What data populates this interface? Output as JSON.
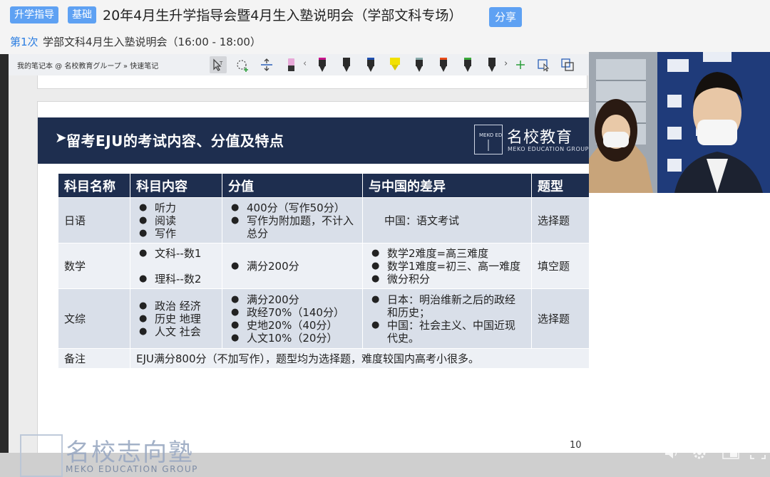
{
  "header": {
    "tags": [
      "升学指导",
      "基础"
    ],
    "title": "20年4月生升学指导会暨4月生入塾说明会（学部文科专场）",
    "share_label": "分享",
    "session_number": "第1次",
    "session_desc": "学部文科4月生入塾说明会（16:00 - 18:00）"
  },
  "toolbar": {
    "breadcrumb": "我的笔记本 @ 名校教育グループ » 快速笔记",
    "pen_colors": [
      "#c7148a",
      "#111111",
      "#1f4fae",
      "#2059c4",
      "#f2e100",
      "#111111",
      "#e84a17",
      "#3aa93a",
      "#111111"
    ]
  },
  "slide": {
    "title": "留考EJU的考试内容、分值及特点",
    "logo_cn": "名校教育",
    "logo_en": "MEKO EDUCATION GROUP",
    "logo_box_text": "MEKO EDU",
    "page_number": "10",
    "table": {
      "headers": [
        "科目名称",
        "科目内容",
        "分值",
        "与中国的差异",
        "题型"
      ],
      "rows": [
        {
          "subject": "日语",
          "content": [
            "听力",
            "阅读",
            "写作"
          ],
          "score": [
            "400分（写作50分）",
            "写作为附加题，不计入总分"
          ],
          "diff_text": "中国：语文考试",
          "type": "选择题"
        },
        {
          "subject": "数学",
          "content": [
            "文科--数1",
            "理科--数2"
          ],
          "score": [
            "满分200分"
          ],
          "diff": [
            "数学2难度=高三难度",
            "数学1难度=初三、高一难度",
            "微分积分"
          ],
          "type": "填空题"
        },
        {
          "subject": "文综",
          "content": [
            "政治 经济",
            "历史 地理",
            "人文 社会"
          ],
          "score": [
            "满分200分",
            "政经70%（140分）",
            "史地20%（40分）",
            "人文10%（20分）"
          ],
          "diff": [
            "日本：明治维新之后的政经和历史；",
            "中国：社会主义、中国近现代史。"
          ],
          "type": "选择题"
        }
      ],
      "note_label": "备注",
      "note_text": "EJU满分800分（不加写作），题型均为选择题，难度较国内高考小很多。"
    }
  },
  "watermark": {
    "cn": "名校志向塾",
    "en": "MEKO EDUCATION GROUP"
  },
  "colors": {
    "accent": "#5ea1f3",
    "banner": "#1e2e4f",
    "table_row": "#d9dfe9",
    "table_row_alt": "#edf0f5"
  }
}
